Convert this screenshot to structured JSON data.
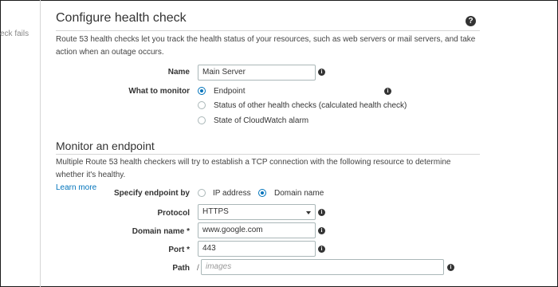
{
  "left_nav": {
    "truncated_item": "eck fails"
  },
  "configure": {
    "title": "Configure health check",
    "help_glyph": "?",
    "description": "Route 53 health checks let you track the health status of your resources, such as web servers or mail servers, and take action when an outage occurs.",
    "name_label": "Name",
    "name_value": "Main Server",
    "monitor_label": "What to monitor",
    "monitor_options": [
      {
        "label": "Endpoint",
        "checked": true
      },
      {
        "label": "Status of other health checks (calculated health check)",
        "checked": false
      },
      {
        "label": "State of CloudWatch alarm",
        "checked": false
      }
    ]
  },
  "endpoint": {
    "title": "Monitor an endpoint",
    "description": "Multiple Route 53 health checkers will try to establish a TCP connection with the following resource to determine whether it's healthy.",
    "learn_more": "Learn more",
    "specify_label": "Specify endpoint by",
    "specify_options": [
      {
        "label": "IP address",
        "checked": false
      },
      {
        "label": "Domain name",
        "checked": true
      }
    ],
    "protocol_label": "Protocol",
    "protocol_value": "HTTPS",
    "domain_label": "Domain name *",
    "domain_value": "www.google.com",
    "port_label": "Port *",
    "port_value": "443",
    "path_label": "Path",
    "path_prefix": "/",
    "path_placeholder": "images"
  },
  "info_glyph": "i",
  "colors": {
    "accent": "#0073bb",
    "text": "#333333",
    "border": "#aab7b8"
  }
}
